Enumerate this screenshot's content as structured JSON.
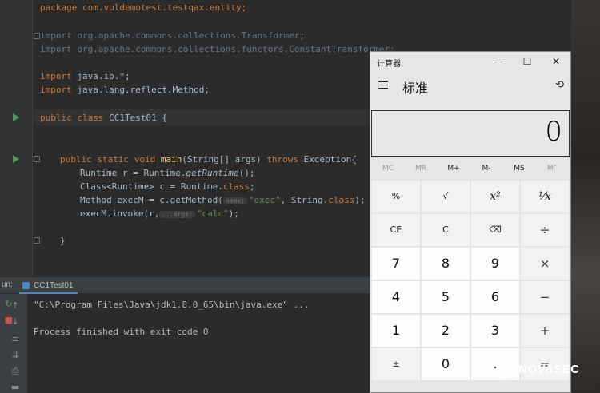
{
  "editor": {
    "lines": {
      "package": "package com.vuldemotest.testqax.entity;",
      "import1": "import org.apache.commons.collections.Transformer;",
      "import2": "import org.apache.commons.collections.functors.ConstantTransformer;",
      "import3_kw": "import",
      "import3_rest": " java.io.*;",
      "import4_kw": "import",
      "import4_rest": " java.lang.reflect.Method;",
      "class_kw": "public class",
      "class_name": " CC1Test01 {",
      "main_kw": "public static void",
      "main_name": "main",
      "main_rest": "(String[] args) ",
      "main_throws": "throws",
      "main_exc": " Exception{",
      "l1_a": "Runtime r = Runtime.",
      "l1_b": "getRuntime",
      "l1_c": "();",
      "l2_a": "Class<Runtime> c = Runtime.",
      "l2_b": "class",
      "l2_c": ";",
      "l3_a": "Method execM = c.getMethod(",
      "l3_hint": "name:",
      "l3_str": "\"exec\"",
      "l3_b": ", String.",
      "l3_kw": "class",
      "l3_c": ");",
      "l4_a": "execM.invoke(r,",
      "l4_hint": "...args:",
      "l4_str": "\"calc\"",
      "l4_c": ");",
      "close1": "}"
    }
  },
  "run_panel": {
    "label": "un:",
    "tab": "CC1Test01",
    "cmd": "\"C:\\Program Files\\Java\\jdk1.8.0_65\\bin\\java.exe\" ...",
    "exit": "Process finished with exit code 0"
  },
  "calculator": {
    "title": "计算器",
    "mode": "标准",
    "display": "0",
    "memory": [
      "MC",
      "MR",
      "M+",
      "M-",
      "MS",
      "M˅"
    ],
    "keys": [
      [
        "%",
        "√",
        "x²",
        "¹⁄x"
      ],
      [
        "CE",
        "C",
        "⌫",
        "÷"
      ],
      [
        "7",
        "8",
        "9",
        "×"
      ],
      [
        "4",
        "5",
        "6",
        "−"
      ],
      [
        "1",
        "2",
        "3",
        "+"
      ],
      [
        "±",
        "0",
        ".",
        "="
      ]
    ]
  },
  "watermark": {
    "text": "NOVASEC"
  }
}
